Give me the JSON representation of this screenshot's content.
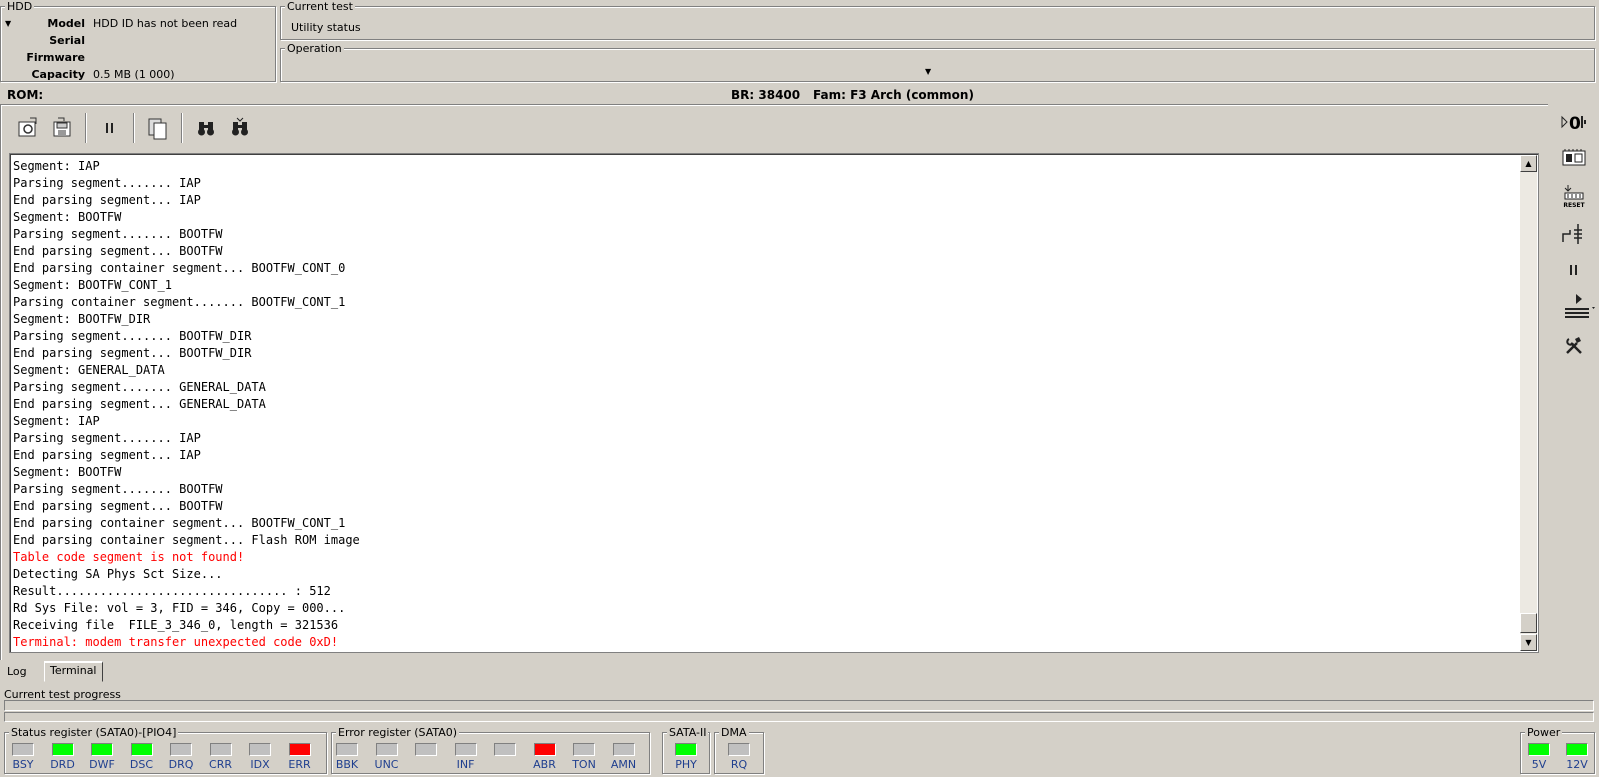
{
  "hdd": {
    "title": "HDD",
    "rows": [
      {
        "key": "Model",
        "value": "HDD ID has not been read"
      },
      {
        "key": "Serial",
        "value": ""
      },
      {
        "key": "Firmware",
        "value": ""
      },
      {
        "key": "Capacity",
        "value": "0.5 MB (1 000)"
      }
    ]
  },
  "current_test": {
    "title": "Current test",
    "value": "Utility status"
  },
  "operation": {
    "title": "Operation"
  },
  "statusline": {
    "rom": "ROM:",
    "br": "BR: 38400",
    "fam": "Fam: F3 Arch (common)"
  },
  "toolbar": {
    "icons": [
      "gear-icon",
      "save-icon",
      "pause-icon",
      "copy-icon",
      "binoculars-icon",
      "binoculars-next-icon"
    ]
  },
  "log": [
    {
      "text": "Segment: IAP",
      "error": false
    },
    {
      "text": "Parsing segment....... IAP",
      "error": false
    },
    {
      "text": "End parsing segment... IAP",
      "error": false
    },
    {
      "text": "Segment: BOOTFW",
      "error": false
    },
    {
      "text": "Parsing segment....... BOOTFW",
      "error": false
    },
    {
      "text": "End parsing segment... BOOTFW",
      "error": false
    },
    {
      "text": "End parsing container segment... BOOTFW_CONT_0",
      "error": false
    },
    {
      "text": "Segment: BOOTFW_CONT_1",
      "error": false
    },
    {
      "text": "Parsing container segment....... BOOTFW_CONT_1",
      "error": false
    },
    {
      "text": "Segment: BOOTFW_DIR",
      "error": false
    },
    {
      "text": "Parsing segment....... BOOTFW_DIR",
      "error": false
    },
    {
      "text": "End parsing segment... BOOTFW_DIR",
      "error": false
    },
    {
      "text": "Segment: GENERAL_DATA",
      "error": false
    },
    {
      "text": "Parsing segment....... GENERAL_DATA",
      "error": false
    },
    {
      "text": "End parsing segment... GENERAL_DATA",
      "error": false
    },
    {
      "text": "Segment: IAP",
      "error": false
    },
    {
      "text": "Parsing segment....... IAP",
      "error": false
    },
    {
      "text": "End parsing segment... IAP",
      "error": false
    },
    {
      "text": "Segment: BOOTFW",
      "error": false
    },
    {
      "text": "Parsing segment....... BOOTFW",
      "error": false
    },
    {
      "text": "End parsing segment... BOOTFW",
      "error": false
    },
    {
      "text": "End parsing container segment... BOOTFW_CONT_1",
      "error": false
    },
    {
      "text": "End parsing container segment... Flash ROM image",
      "error": false
    },
    {
      "text": "Table code segment is not found!",
      "error": true
    },
    {
      "text": "Detecting SA Phys Sct Size...",
      "error": false
    },
    {
      "text": "Result................................ : 512",
      "error": false
    },
    {
      "text": "Rd Sys File: vol = 3, FID = 346, Copy = 000...",
      "error": false
    },
    {
      "text": "Receiving file  FILE_3_346_0, length = 321536",
      "error": false
    },
    {
      "text": "Terminal: modem transfer unexpected code 0xD!",
      "error": true
    }
  ],
  "tabs": [
    {
      "label": "Log",
      "active": false
    },
    {
      "label": "Terminal",
      "active": true
    }
  ],
  "progress": {
    "label": "Current test progress",
    "value": 0
  },
  "status_register": {
    "title": "Status register (SATA0)-[PIO4]",
    "leds": [
      {
        "label": "BSY",
        "state": "off"
      },
      {
        "label": "DRD",
        "state": "green"
      },
      {
        "label": "DWF",
        "state": "green"
      },
      {
        "label": "DSC",
        "state": "green"
      },
      {
        "label": "DRQ",
        "state": "off"
      },
      {
        "label": "CRR",
        "state": "off"
      },
      {
        "label": "IDX",
        "state": "off"
      },
      {
        "label": "ERR",
        "state": "red"
      }
    ]
  },
  "error_register": {
    "title": "Error register (SATA0)",
    "leds": [
      {
        "label": "BBK",
        "state": "off"
      },
      {
        "label": "UNC",
        "state": "off"
      },
      {
        "label": "",
        "state": "off"
      },
      {
        "label": "INF",
        "state": "off"
      },
      {
        "label": "",
        "state": "off"
      },
      {
        "label": "ABR",
        "state": "red"
      },
      {
        "label": "TON",
        "state": "off"
      },
      {
        "label": "AMN",
        "state": "off"
      }
    ]
  },
  "sata": {
    "title": "SATA-II",
    "leds": [
      {
        "label": "PHY",
        "state": "green"
      }
    ]
  },
  "dma": {
    "title": "DMA",
    "leds": [
      {
        "label": "RQ",
        "state": "off"
      }
    ]
  },
  "power": {
    "title": "Power",
    "leds": [
      {
        "label": "5V",
        "state": "green"
      },
      {
        "label": "12V",
        "state": "green"
      }
    ]
  },
  "right_toolbar": {
    "icons": [
      "power-zero-icon",
      "board-icon",
      "reset-icon",
      "jumper-icon",
      "pause-icon",
      "play-config-icon",
      "tools-icon"
    ],
    "reset_label": "RESET"
  },
  "colors": {
    "background": "#d4d0c8",
    "led_green": "#00ff00",
    "led_red": "#ff0000",
    "error_text": "#ff0000",
    "led_label": "#1f3f8f"
  }
}
